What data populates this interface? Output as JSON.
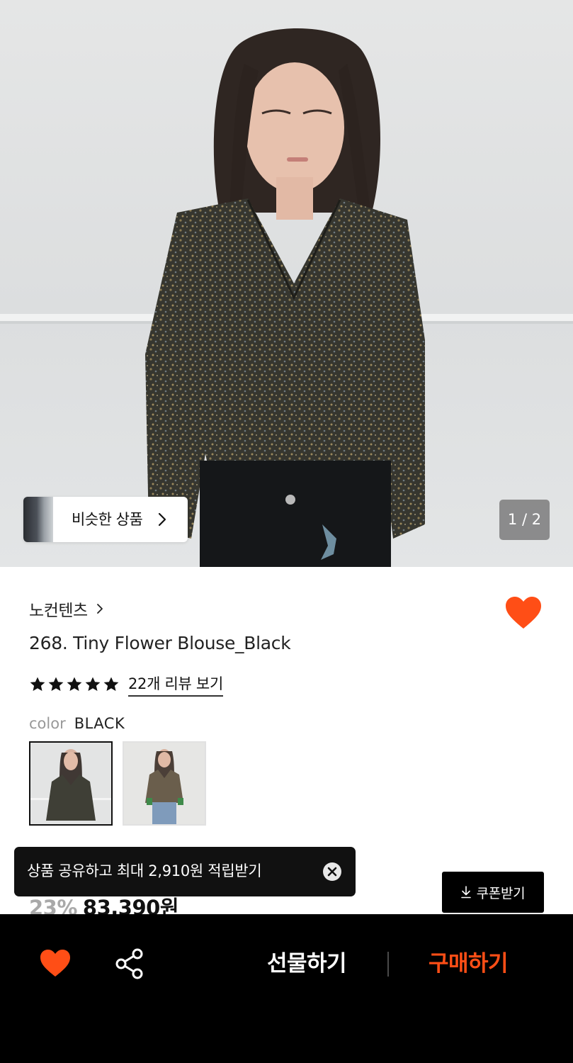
{
  "colors": {
    "accent_orange": "#ff4e16",
    "bottom_bar_bg": "#000000",
    "toast_bg": "#111111",
    "discount_gray": "#a9a9a9"
  },
  "hero": {
    "image_alt": "model wearing floral blouse",
    "similar_label": "비슷한 상품",
    "similar_icon": "chevron-right-icon",
    "pager": "1 / 2"
  },
  "product": {
    "brand": "노컨텐츠",
    "brand_icon": "chevron-right-icon",
    "favorite_icon": "heart-icon",
    "title": "268. Tiny Flower Blouse_Black",
    "rating": {
      "stars": 5,
      "max": 5,
      "review_link": "22개 리뷰 보기"
    },
    "color_label": "color",
    "color_value": "BLACK",
    "swatches_selected_index": 0
  },
  "price": {
    "discount": "23%",
    "amount": "83,390원"
  },
  "toast": {
    "text": "상품 공유하고 최대 2,910원 적립받기",
    "close_icon": "close-circle-icon"
  },
  "coupon": {
    "label": "쿠폰받기",
    "icon": "download-icon"
  },
  "bottom_bar": {
    "heart_icon": "heart-icon",
    "share_icon": "share-icon",
    "gift_label": "선물하기",
    "buy_label": "구매하기"
  }
}
